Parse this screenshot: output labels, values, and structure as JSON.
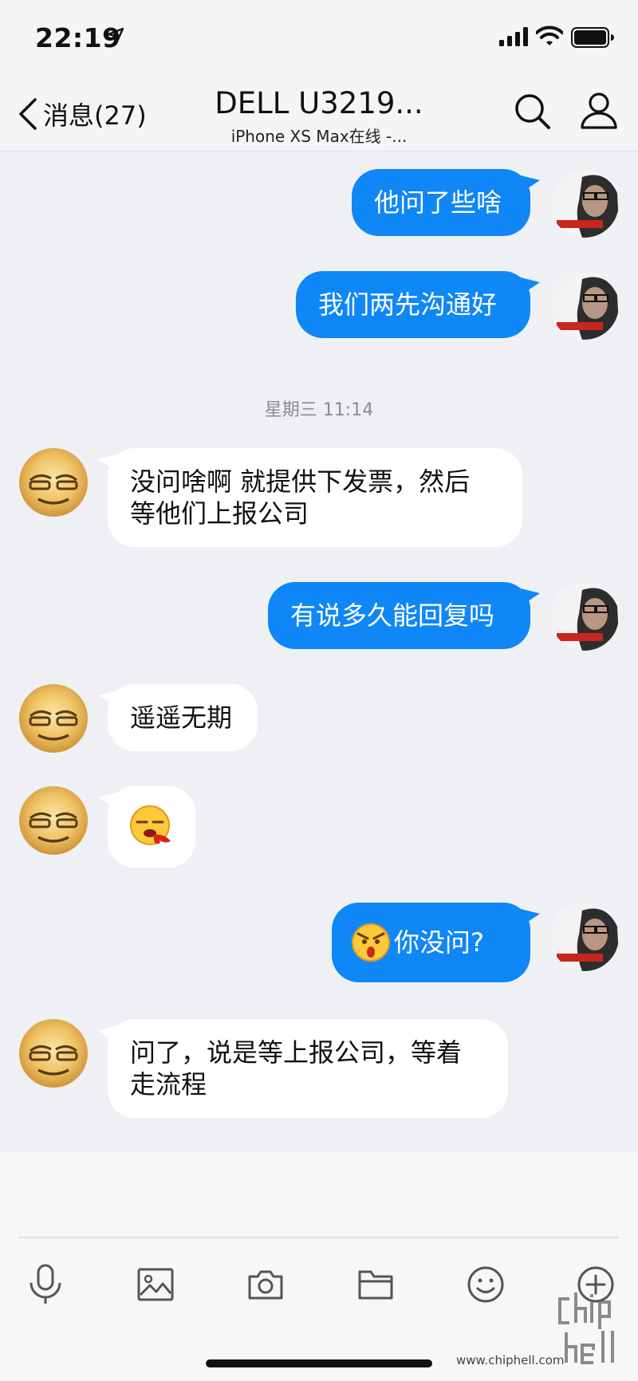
{
  "status_bar": {
    "time": "22:19"
  },
  "nav": {
    "back_label": "消息(27)",
    "title": "DELL U3219...",
    "subtitle": "iPhone XS Max在线 -..."
  },
  "messages": [
    {
      "dir": "out",
      "text": "他问了些啥"
    },
    {
      "dir": "out",
      "text": "我们两先沟通好"
    },
    {
      "timestamp": "星期三 11:14"
    },
    {
      "dir": "in",
      "text_line1": "没问啥啊  就提供下发票，然后",
      "text_line2": "等他们上报公司"
    },
    {
      "dir": "out",
      "text": "有说多久能回复吗"
    },
    {
      "dir": "in",
      "text": "遥遥无期"
    },
    {
      "dir": "in",
      "emoji": "spitting-blood-emoji"
    },
    {
      "dir": "out",
      "emoji": "angry-emoji",
      "text": "你没问?"
    },
    {
      "dir": "in",
      "text_line1": "问了，说是等上报公司，等着",
      "text_line2": "走流程"
    }
  ],
  "toolbar": {
    "icons": [
      "microphone-icon",
      "image-icon",
      "camera-icon",
      "folder-icon",
      "smiley-icon",
      "plus-icon"
    ]
  },
  "watermark": {
    "url": "www.chiphell.com",
    "logo_text": "chip hell"
  },
  "colors": {
    "outgoing_bubble": "#0f87f6",
    "incoming_bubble": "#ffffff",
    "background": "#eff0f4"
  }
}
